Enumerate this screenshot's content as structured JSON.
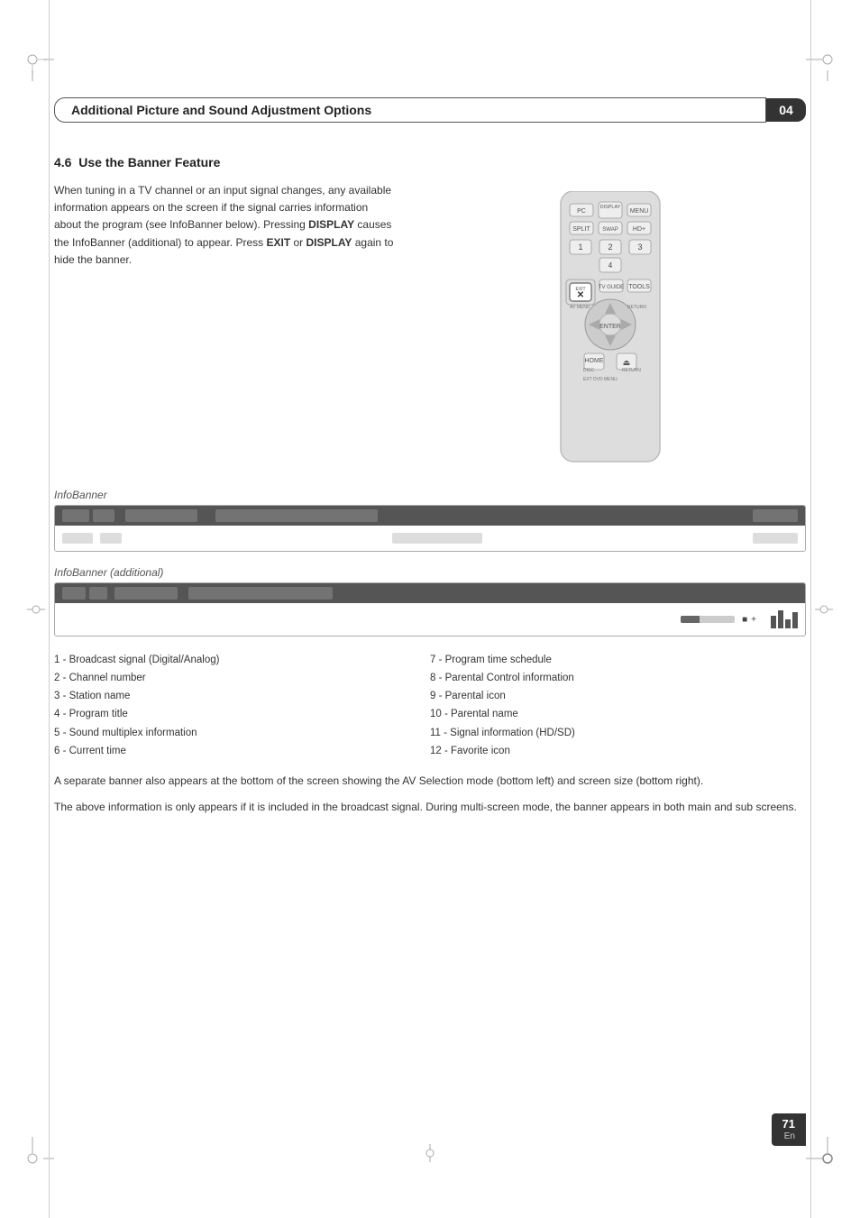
{
  "header": {
    "title": "Additional Picture and Sound Adjustment Options",
    "chapter": "04"
  },
  "section": {
    "number": "4.6",
    "title": "Use the Banner Feature"
  },
  "body_text": {
    "paragraph": "When tuning in a TV channel or an input signal changes, any available information appears on the screen if the signal carries information about the program (see InfoBanner below). Pressing DISPLAY causes the InfoBanner (additional) to appear. Press EXIT or DISPLAY again to hide the banner.",
    "bold_words": [
      "DISPLAY",
      "EXIT",
      "DISPLAY"
    ]
  },
  "infobanner_label": "InfoBanner",
  "infobanner_additional_label": "InfoBanner (additional)",
  "numbered_items": {
    "left_col": [
      "1 - Broadcast signal (Digital/Analog)",
      "2 - Channel number",
      "3 - Station name",
      "4 - Program title",
      "5 - Sound multiplex information",
      "6 - Current time"
    ],
    "right_col": [
      "7 - Program time schedule",
      "8 - Parental Control information",
      "9 - Parental icon",
      "10 - Parental name",
      "11 - Signal information (HD/SD)",
      "12 - Favorite icon"
    ]
  },
  "bottom_paragraphs": [
    "A separate banner also appears at the bottom of the screen showing the AV Selection mode (bottom left) and screen size (bottom right).",
    "The above information is only appears if it is included in the broadcast signal. During multi-screen mode, the banner appears in both main and sub screens."
  ],
  "page_number": "71",
  "page_lang": "En"
}
